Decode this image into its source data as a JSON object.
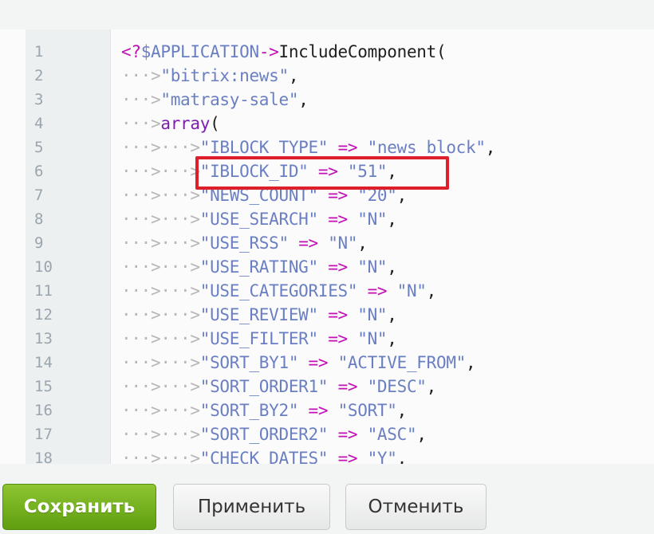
{
  "editor": {
    "lines": [
      {
        "n": "1",
        "tokens": [
          {
            "t": "<?",
            "c": "op"
          },
          {
            "t": "$APPLICATION",
            "c": "str"
          },
          {
            "t": "->",
            "c": "op"
          },
          {
            "t": "IncludeComponent(",
            "c": "plain"
          }
        ]
      },
      {
        "n": "2",
        "tokens": [
          {
            "t": "···>",
            "c": "ws"
          },
          {
            "t": "\"bitrix:news\"",
            "c": "str"
          },
          {
            "t": ",",
            "c": "plain"
          }
        ]
      },
      {
        "n": "3",
        "tokens": [
          {
            "t": "···>",
            "c": "ws"
          },
          {
            "t": "\"matrasy-sale\"",
            "c": "str"
          },
          {
            "t": ",",
            "c": "plain"
          }
        ]
      },
      {
        "n": "4",
        "tokens": [
          {
            "t": "···>",
            "c": "ws"
          },
          {
            "t": "array",
            "c": "kw"
          },
          {
            "t": "(",
            "c": "plain"
          }
        ]
      },
      {
        "n": "5",
        "tokens": [
          {
            "t": "···>···>",
            "c": "ws"
          },
          {
            "t": "\"IBLOCK_TYPE\"",
            "c": "str"
          },
          {
            "t": " ",
            "c": "plain"
          },
          {
            "t": "=>",
            "c": "op"
          },
          {
            "t": " ",
            "c": "plain"
          },
          {
            "t": "\"news_block\"",
            "c": "str"
          },
          {
            "t": ",",
            "c": "plain"
          }
        ]
      },
      {
        "n": "6",
        "tokens": [
          {
            "t": "···>···>",
            "c": "ws"
          },
          {
            "t": "\"IBLOCK_ID\"",
            "c": "str"
          },
          {
            "t": " ",
            "c": "plain"
          },
          {
            "t": "=>",
            "c": "op"
          },
          {
            "t": " ",
            "c": "plain"
          },
          {
            "t": "\"51\"",
            "c": "str"
          },
          {
            "t": ",",
            "c": "plain"
          }
        ]
      },
      {
        "n": "7",
        "tokens": [
          {
            "t": "···>···>",
            "c": "ws"
          },
          {
            "t": "\"NEWS_COUNT\"",
            "c": "str"
          },
          {
            "t": " ",
            "c": "plain"
          },
          {
            "t": "=>",
            "c": "op"
          },
          {
            "t": " ",
            "c": "plain"
          },
          {
            "t": "\"20\"",
            "c": "str"
          },
          {
            "t": ",",
            "c": "plain"
          }
        ]
      },
      {
        "n": "8",
        "tokens": [
          {
            "t": "···>···>",
            "c": "ws"
          },
          {
            "t": "\"USE_SEARCH\"",
            "c": "str"
          },
          {
            "t": " ",
            "c": "plain"
          },
          {
            "t": "=>",
            "c": "op"
          },
          {
            "t": " ",
            "c": "plain"
          },
          {
            "t": "\"N\"",
            "c": "str"
          },
          {
            "t": ",",
            "c": "plain"
          }
        ]
      },
      {
        "n": "9",
        "tokens": [
          {
            "t": "···>···>",
            "c": "ws"
          },
          {
            "t": "\"USE_RSS\"",
            "c": "str"
          },
          {
            "t": " ",
            "c": "plain"
          },
          {
            "t": "=>",
            "c": "op"
          },
          {
            "t": " ",
            "c": "plain"
          },
          {
            "t": "\"N\"",
            "c": "str"
          },
          {
            "t": ",",
            "c": "plain"
          }
        ]
      },
      {
        "n": "10",
        "tokens": [
          {
            "t": "···>···>",
            "c": "ws"
          },
          {
            "t": "\"USE_RATING\"",
            "c": "str"
          },
          {
            "t": " ",
            "c": "plain"
          },
          {
            "t": "=>",
            "c": "op"
          },
          {
            "t": " ",
            "c": "plain"
          },
          {
            "t": "\"N\"",
            "c": "str"
          },
          {
            "t": ",",
            "c": "plain"
          }
        ]
      },
      {
        "n": "11",
        "tokens": [
          {
            "t": "···>···>",
            "c": "ws"
          },
          {
            "t": "\"USE_CATEGORIES\"",
            "c": "str"
          },
          {
            "t": " ",
            "c": "plain"
          },
          {
            "t": "=>",
            "c": "op"
          },
          {
            "t": " ",
            "c": "plain"
          },
          {
            "t": "\"N\"",
            "c": "str"
          },
          {
            "t": ",",
            "c": "plain"
          }
        ]
      },
      {
        "n": "12",
        "tokens": [
          {
            "t": "···>···>",
            "c": "ws"
          },
          {
            "t": "\"USE_REVIEW\"",
            "c": "str"
          },
          {
            "t": " ",
            "c": "plain"
          },
          {
            "t": "=>",
            "c": "op"
          },
          {
            "t": " ",
            "c": "plain"
          },
          {
            "t": "\"N\"",
            "c": "str"
          },
          {
            "t": ",",
            "c": "plain"
          }
        ]
      },
      {
        "n": "13",
        "tokens": [
          {
            "t": "···>···>",
            "c": "ws"
          },
          {
            "t": "\"USE_FILTER\"",
            "c": "str"
          },
          {
            "t": " ",
            "c": "plain"
          },
          {
            "t": "=>",
            "c": "op"
          },
          {
            "t": " ",
            "c": "plain"
          },
          {
            "t": "\"N\"",
            "c": "str"
          },
          {
            "t": ",",
            "c": "plain"
          }
        ]
      },
      {
        "n": "14",
        "tokens": [
          {
            "t": "···>···>",
            "c": "ws"
          },
          {
            "t": "\"SORT_BY1\"",
            "c": "str"
          },
          {
            "t": " ",
            "c": "plain"
          },
          {
            "t": "=>",
            "c": "op"
          },
          {
            "t": " ",
            "c": "plain"
          },
          {
            "t": "\"ACTIVE_FROM\"",
            "c": "str"
          },
          {
            "t": ",",
            "c": "plain"
          }
        ]
      },
      {
        "n": "15",
        "tokens": [
          {
            "t": "···>···>",
            "c": "ws"
          },
          {
            "t": "\"SORT_ORDER1\"",
            "c": "str"
          },
          {
            "t": " ",
            "c": "plain"
          },
          {
            "t": "=>",
            "c": "op"
          },
          {
            "t": " ",
            "c": "plain"
          },
          {
            "t": "\"DESC\"",
            "c": "str"
          },
          {
            "t": ",",
            "c": "plain"
          }
        ]
      },
      {
        "n": "16",
        "tokens": [
          {
            "t": "···>···>",
            "c": "ws"
          },
          {
            "t": "\"SORT_BY2\"",
            "c": "str"
          },
          {
            "t": " ",
            "c": "plain"
          },
          {
            "t": "=>",
            "c": "op"
          },
          {
            "t": " ",
            "c": "plain"
          },
          {
            "t": "\"SORT\"",
            "c": "str"
          },
          {
            "t": ",",
            "c": "plain"
          }
        ]
      },
      {
        "n": "17",
        "tokens": [
          {
            "t": "···>···>",
            "c": "ws"
          },
          {
            "t": "\"SORT_ORDER2\"",
            "c": "str"
          },
          {
            "t": " ",
            "c": "plain"
          },
          {
            "t": "=>",
            "c": "op"
          },
          {
            "t": " ",
            "c": "plain"
          },
          {
            "t": "\"ASC\"",
            "c": "str"
          },
          {
            "t": ",",
            "c": "plain"
          }
        ]
      },
      {
        "n": "18",
        "tokens": [
          {
            "t": "···>···>",
            "c": "ws"
          },
          {
            "t": "\"CHECK_DATES\"",
            "c": "str"
          },
          {
            "t": " ",
            "c": "plain"
          },
          {
            "t": "=>",
            "c": "op"
          },
          {
            "t": " ",
            "c": "plain"
          },
          {
            "t": "\"Y\"",
            "c": "str"
          },
          {
            "t": ",",
            "c": "plain"
          }
        ]
      }
    ]
  },
  "footer": {
    "save_label": "Сохранить",
    "apply_label": "Применить",
    "cancel_label": "Отменить"
  },
  "colors": {
    "highlight_border": "#dc1f2b",
    "save_button": "#6aab17",
    "string": "#6a7fc2",
    "operator": "#c20fb6",
    "keyword": "#7d1eaf"
  }
}
